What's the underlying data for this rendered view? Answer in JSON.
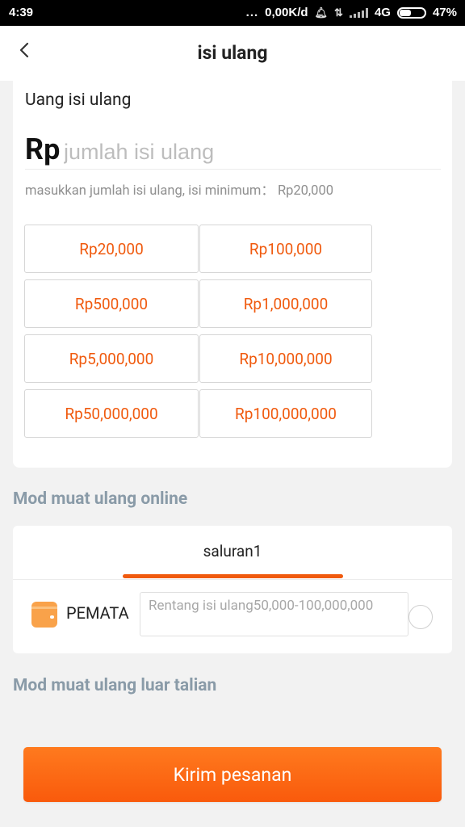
{
  "status_bar": {
    "time": "4:39",
    "dots": "...",
    "speed": "0,00K/d",
    "network": "4G",
    "battery": "47%"
  },
  "header": {
    "back_icon": "chevron-left-icon",
    "title": "isi ulang"
  },
  "topup": {
    "label": "Uang isi ulang",
    "currency_prefix": "Rp",
    "amount_placeholder": "jumlah isi ulang",
    "hint": "masukkan jumlah isi ulang, isi minimum： Rp20,000",
    "presets": [
      "Rp20,000",
      "Rp100,000",
      "Rp500,000",
      "Rp1,000,000",
      "Rp5,000,000",
      "Rp10,000,000",
      "Rp50,000,000",
      "Rp100,000,000"
    ]
  },
  "online": {
    "section_title": "Mod muat ulang online",
    "tab_label": "saluran1",
    "method": {
      "icon": "wallet-icon",
      "name": "PEMATA",
      "range_text": "Rentang isi ulang50,000-100,000,000"
    }
  },
  "offline": {
    "section_title": "Mod muat ulang luar talian"
  },
  "submit_label": "Kirim pesanan",
  "colors": {
    "accent": "#f05a0e",
    "section_title": "#8a9ba8",
    "wallet_icon": "#f9a24a"
  }
}
